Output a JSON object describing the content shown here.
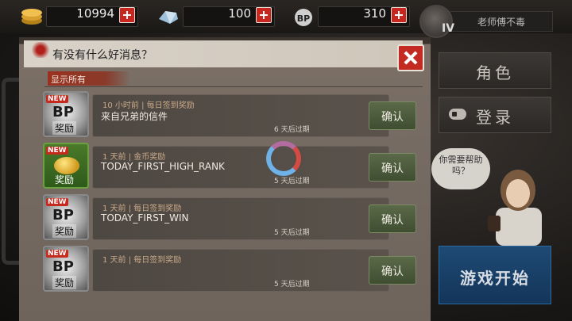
{
  "resources": {
    "gold": {
      "value": "10994"
    },
    "crystal": {
      "value": "100"
    },
    "bp": {
      "value": "310"
    }
  },
  "player": {
    "name": "老师傅不毒",
    "level_label": "IV"
  },
  "dialog": {
    "title": "有没有什么好消息？",
    "filter_label": "显示所有",
    "messages": [
      {
        "meta": "10 小时前 | 每日签到奖励",
        "text": "来自兄弟的信件",
        "expires": "6  天后过期",
        "reward": "BP",
        "new": "NEW",
        "reward_label": "奖励",
        "confirm": "确认"
      },
      {
        "meta": "1 天前 | 金币奖励",
        "text": "TODAY_FIRST_HIGH_RANK",
        "expires": "5  天后过期",
        "reward": "gold",
        "new": "NEW",
        "reward_label": "奖励",
        "confirm": "确认"
      },
      {
        "meta": "1 天前 | 每日签到奖励",
        "text": "TODAY_FIRST_WIN",
        "expires": "5  天后过期",
        "reward": "BP",
        "new": "NEW",
        "reward_label": "奖励",
        "confirm": "确认"
      },
      {
        "meta": "1 天前 | 每日签到奖励",
        "text": "",
        "expires": "5  天后过期",
        "reward": "BP",
        "new": "NEW",
        "reward_label": "奖励",
        "confirm": "确认"
      }
    ]
  },
  "side_menu": {
    "character": "角色",
    "login": "登录",
    "help": "你需要帮助吗？",
    "start": "游戏开始"
  },
  "colors": {
    "accent_red": "#c22a22",
    "confirm_green": "#4f5e3d",
    "start_blue": "#1a4470"
  }
}
